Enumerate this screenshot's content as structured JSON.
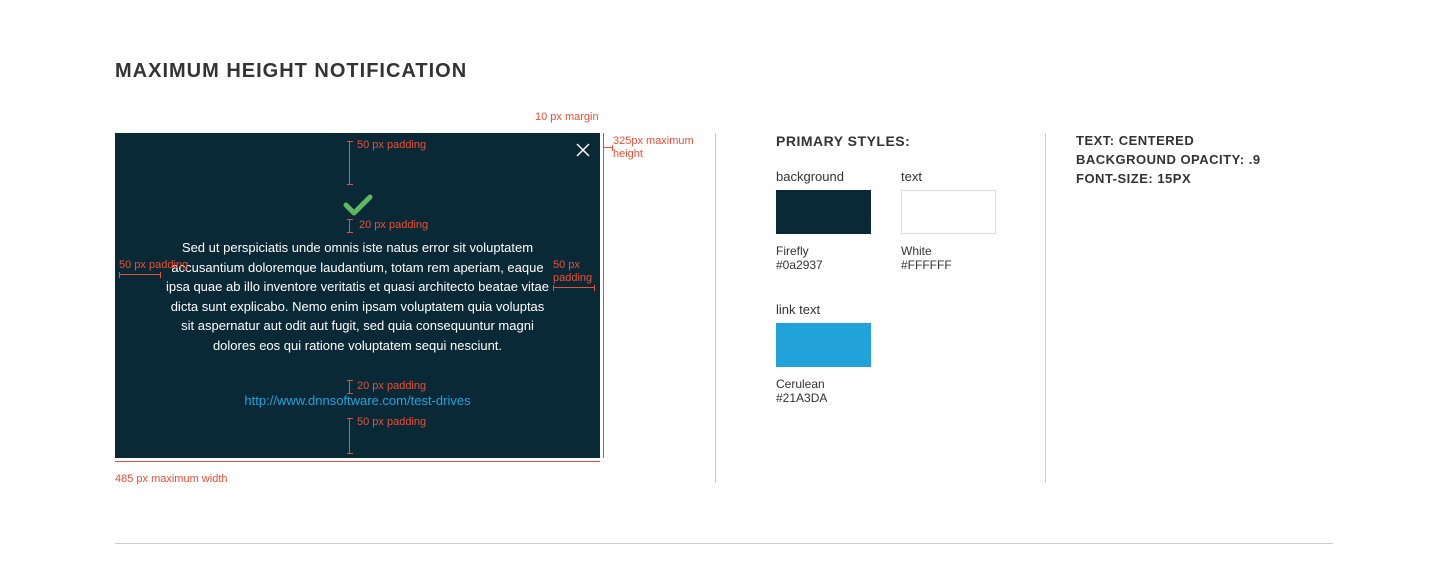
{
  "title": "MAXIMUM HEIGHT NOTIFICATION",
  "notification": {
    "body": "Sed ut perspiciatis unde omnis iste natus error sit voluptatem accusantium doloremque laudantium, totam rem aperiam, eaque ipsa quae ab illo inventore veritatis et quasi architecto beatae vitae dicta sunt explicabo. Nemo enim ipsam voluptatem quia voluptas sit aspernatur aut odit aut fugit, sed quia consequuntur magni dolores eos qui ratione voluptatem sequi nesciunt.",
    "link": "http://www.dnnsoftware.com/test-drives"
  },
  "annotations": {
    "top_margin": "10 px margin",
    "max_height": "325px maximum height",
    "pad_top": "50 px padding",
    "pad_icon_body": "20 px padding",
    "pad_left": "50 px padding",
    "pad_right": "50 px padding",
    "pad_body_link": "20 px padding",
    "pad_bottom": "50 px padding",
    "max_width": "485 px maximum width"
  },
  "styles": {
    "heading": "PRIMARY STYLES:",
    "swatches": {
      "background": {
        "label": "background",
        "name": "Firefly",
        "hex": "#0a2937"
      },
      "text": {
        "label": "text",
        "name": "White",
        "hex": "#FFFFFF"
      },
      "link": {
        "label": "link text",
        "name": "Cerulean",
        "hex": "#21A3DA"
      }
    }
  },
  "specs": {
    "line1": "TEXT: CENTERED",
    "line2": "BACKGROUND OPACITY: .9",
    "line3": "FONT-SIZE: 15PX"
  }
}
